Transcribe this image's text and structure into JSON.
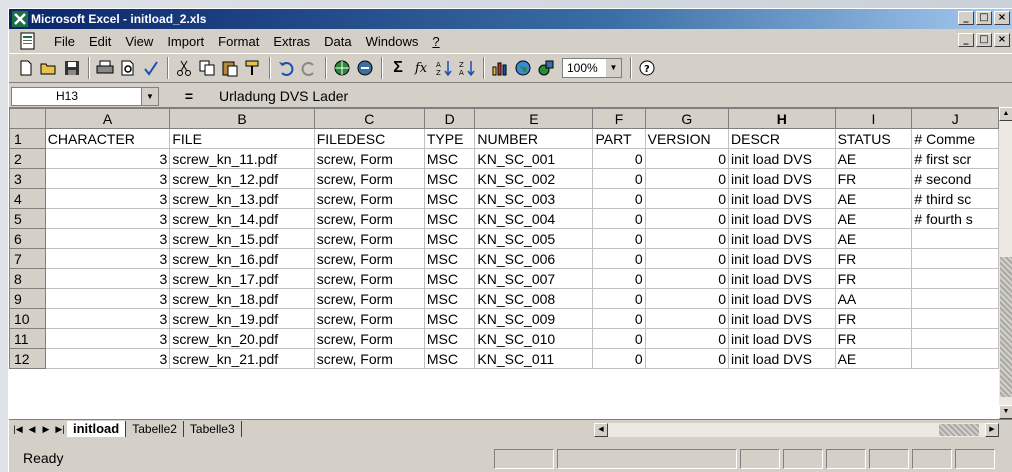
{
  "window": {
    "title": "Microsoft Excel - initload_2.xls",
    "buttons": {
      "minimize": "_",
      "maximize": "□",
      "close": "×"
    }
  },
  "menu": [
    "File",
    "Edit",
    "View",
    "Import",
    "Format",
    "Extras",
    "Data",
    "Windows",
    "?"
  ],
  "toolbar": {
    "zoom": "100%",
    "sum_label": "Σ",
    "fx_label": "fx"
  },
  "formula_bar": {
    "name_box": "H13",
    "equals": "=",
    "content": "Urladung DVS Lader"
  },
  "columns": [
    "A",
    "B",
    "C",
    "D",
    "E",
    "F",
    "G",
    "H",
    "I",
    "J"
  ],
  "selected_column": "H",
  "rows": [
    {
      "n": "1",
      "cells": [
        "CHARACTER",
        "FILE",
        "FILEDESC",
        "TYPE",
        "NUMBER",
        "PART",
        "VERSION",
        "DESCR",
        "STATUS",
        "# Comme"
      ]
    },
    {
      "n": "2",
      "cells": [
        "3",
        "screw_kn_11.pdf",
        "screw, Form",
        "MSC",
        "KN_SC_001",
        "0",
        "0",
        "init load DVS",
        "AE",
        "# first scr"
      ]
    },
    {
      "n": "3",
      "cells": [
        "3",
        "screw_kn_12.pdf",
        "screw, Form",
        "MSC",
        "KN_SC_002",
        "0",
        "0",
        "init load DVS",
        "FR",
        "# second"
      ]
    },
    {
      "n": "4",
      "cells": [
        "3",
        "screw_kn_13.pdf",
        "screw, Form",
        "MSC",
        "KN_SC_003",
        "0",
        "0",
        "init load DVS",
        "AE",
        "# third sc"
      ]
    },
    {
      "n": "5",
      "cells": [
        "3",
        "screw_kn_14.pdf",
        "screw, Form",
        "MSC",
        "KN_SC_004",
        "0",
        "0",
        "init load DVS",
        "AE",
        "# fourth s"
      ]
    },
    {
      "n": "6",
      "cells": [
        "3",
        "screw_kn_15.pdf",
        "screw, Form",
        "MSC",
        "KN_SC_005",
        "0",
        "0",
        "init load DVS",
        "AE",
        ""
      ]
    },
    {
      "n": "7",
      "cells": [
        "3",
        "screw_kn_16.pdf",
        "screw, Form",
        "MSC",
        "KN_SC_006",
        "0",
        "0",
        "init load DVS",
        "FR",
        ""
      ]
    },
    {
      "n": "8",
      "cells": [
        "3",
        "screw_kn_17.pdf",
        "screw, Form",
        "MSC",
        "KN_SC_007",
        "0",
        "0",
        "init load DVS",
        "FR",
        ""
      ]
    },
    {
      "n": "9",
      "cells": [
        "3",
        "screw_kn_18.pdf",
        "screw, Form",
        "MSC",
        "KN_SC_008",
        "0",
        "0",
        "init load DVS",
        "AA",
        ""
      ]
    },
    {
      "n": "10",
      "cells": [
        "3",
        "screw_kn_19.pdf",
        "screw, Form",
        "MSC",
        "KN_SC_009",
        "0",
        "0",
        "init load DVS",
        "FR",
        ""
      ]
    },
    {
      "n": "11",
      "cells": [
        "3",
        "screw_kn_20.pdf",
        "screw, Form",
        "MSC",
        "KN_SC_010",
        "0",
        "0",
        "init load DVS",
        "FR",
        ""
      ]
    },
    {
      "n": "12",
      "cells": [
        "3",
        "screw_kn_21.pdf",
        "screw, Form",
        "MSC",
        "KN_SC_011",
        "0",
        "0",
        "init load DVS",
        "AE",
        ""
      ]
    }
  ],
  "sheets": [
    "initload",
    "Tabelle2",
    "Tabelle3"
  ],
  "active_sheet": "initload",
  "status": "Ready",
  "icons": [
    "excel-icon",
    "new-icon",
    "open-icon",
    "save-icon",
    "print-icon",
    "print-preview-icon",
    "spellcheck-icon",
    "cut-icon",
    "copy-icon",
    "paste-icon",
    "format-painter-icon",
    "undo-icon",
    "redo-icon",
    "web-icon",
    "hyperlink-icon",
    "autosum-icon",
    "function-icon",
    "sort-ascending-icon",
    "sort-descending-icon",
    "chart-wizard-icon",
    "map-icon",
    "drawing-icon",
    "help-icon"
  ]
}
